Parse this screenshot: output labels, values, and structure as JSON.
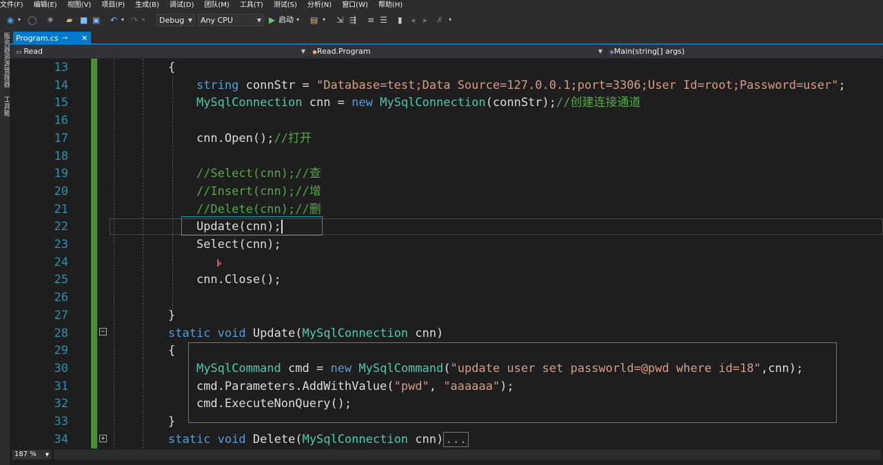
{
  "menu": [
    "文件(F)",
    "编辑(E)",
    "视图(V)",
    "项目(P)",
    "生成(B)",
    "调试(D)",
    "团队(M)",
    "工具(T)",
    "测试(S)",
    "分析(N)",
    "窗口(W)",
    "帮助(H)"
  ],
  "toolbar": {
    "config": "Debug",
    "platform": "Any CPU",
    "start_label": "启动"
  },
  "side_panel": {
    "server_explorer": "服务器资源管理器",
    "toolbox": "工具箱"
  },
  "tab": {
    "filename": "Program.cs",
    "pin": "⊸",
    "close": "✕"
  },
  "navbar": {
    "project": "Read",
    "class": "Read.Program",
    "member": "Main(string[] args)"
  },
  "lines": [
    {
      "n": "13",
      "tokens": [
        {
          "t": "{",
          "c": ""
        }
      ]
    },
    {
      "n": "14",
      "tokens": [
        {
          "t": "    ",
          "c": ""
        },
        {
          "t": "string",
          "c": "kw"
        },
        {
          "t": " connStr = ",
          "c": ""
        },
        {
          "t": "\"Database=test;Data Source=127.0.0.1;port=3306;User Id=root;Password=user\"",
          "c": "str"
        },
        {
          "t": ";",
          "c": ""
        }
      ]
    },
    {
      "n": "15",
      "tokens": [
        {
          "t": "    ",
          "c": ""
        },
        {
          "t": "MySqlConnection",
          "c": "ty"
        },
        {
          "t": " cnn = ",
          "c": ""
        },
        {
          "t": "new",
          "c": "kw"
        },
        {
          "t": " ",
          "c": ""
        },
        {
          "t": "MySqlConnection",
          "c": "ty"
        },
        {
          "t": "(connStr);",
          "c": ""
        },
        {
          "t": "//创建连接通道",
          "c": "cm"
        }
      ]
    },
    {
      "n": "16",
      "tokens": []
    },
    {
      "n": "17",
      "tokens": [
        {
          "t": "    cnn.Open();",
          "c": ""
        },
        {
          "t": "//打开",
          "c": "cm"
        }
      ]
    },
    {
      "n": "18",
      "tokens": []
    },
    {
      "n": "19",
      "tokens": [
        {
          "t": "    ",
          "c": ""
        },
        {
          "t": "//Select(cnn);//查",
          "c": "cm"
        }
      ]
    },
    {
      "n": "20",
      "tokens": [
        {
          "t": "    ",
          "c": ""
        },
        {
          "t": "//Insert(cnn);//增",
          "c": "cm"
        }
      ]
    },
    {
      "n": "21",
      "tokens": [
        {
          "t": "    ",
          "c": ""
        },
        {
          "t": "//Delete(cnn);//删",
          "c": "cm"
        }
      ]
    },
    {
      "n": "22",
      "tokens": [
        {
          "t": "    Update(cnn);",
          "c": ""
        }
      ]
    },
    {
      "n": "23",
      "tokens": [
        {
          "t": "    Select(cnn);",
          "c": ""
        }
      ]
    },
    {
      "n": "24",
      "tokens": []
    },
    {
      "n": "25",
      "tokens": [
        {
          "t": "    cnn.Close();",
          "c": ""
        }
      ]
    },
    {
      "n": "26",
      "tokens": []
    },
    {
      "n": "27",
      "tokens": [
        {
          "t": "}",
          "c": ""
        }
      ]
    },
    {
      "n": "28",
      "tokens": [
        {
          "t": "static",
          "c": "kw"
        },
        {
          "t": " ",
          "c": ""
        },
        {
          "t": "void",
          "c": "kw"
        },
        {
          "t": " Update(",
          "c": ""
        },
        {
          "t": "MySqlConnection",
          "c": "ty"
        },
        {
          "t": " cnn)",
          "c": ""
        }
      ]
    },
    {
      "n": "29",
      "tokens": [
        {
          "t": "{",
          "c": ""
        }
      ]
    },
    {
      "n": "30",
      "tokens": [
        {
          "t": "    ",
          "c": ""
        },
        {
          "t": "MySqlCommand",
          "c": "ty"
        },
        {
          "t": " cmd = ",
          "c": ""
        },
        {
          "t": "new",
          "c": "kw"
        },
        {
          "t": " ",
          "c": ""
        },
        {
          "t": "MySqlCommand",
          "c": "ty"
        },
        {
          "t": "(",
          "c": ""
        },
        {
          "t": "\"update user set passworld=@pwd where id=18\"",
          "c": "str"
        },
        {
          "t": ",cnn);",
          "c": ""
        }
      ]
    },
    {
      "n": "31",
      "tokens": [
        {
          "t": "    cmd.Parameters.AddWithValue(",
          "c": ""
        },
        {
          "t": "\"pwd\"",
          "c": "str"
        },
        {
          "t": ", ",
          "c": ""
        },
        {
          "t": "\"aaaaaa\"",
          "c": "str"
        },
        {
          "t": ");",
          "c": ""
        }
      ]
    },
    {
      "n": "32",
      "tokens": [
        {
          "t": "    cmd.ExecuteNonQuery();",
          "c": ""
        }
      ]
    },
    {
      "n": "33",
      "tokens": [
        {
          "t": "}",
          "c": ""
        }
      ]
    },
    {
      "n": "34",
      "tokens": [
        {
          "t": "static",
          "c": "kw"
        },
        {
          "t": " ",
          "c": ""
        },
        {
          "t": "void",
          "c": "kw"
        },
        {
          "t": " Delete(",
          "c": ""
        },
        {
          "t": "MySqlConnection",
          "c": "ty"
        },
        {
          "t": " cnn)",
          "c": ""
        }
      ]
    }
  ],
  "collapsed_marker": "...",
  "fold_minus": "−",
  "fold_plus": "+",
  "status": {
    "zoom": "187 %"
  },
  "colors": {
    "keyword": "#569cd6",
    "type": "#4ec9b0",
    "string": "#d69d85",
    "comment": "#57a64a",
    "line_number": "#2b91af",
    "accent": "#007acc",
    "change_bar": "#4c8c33"
  }
}
